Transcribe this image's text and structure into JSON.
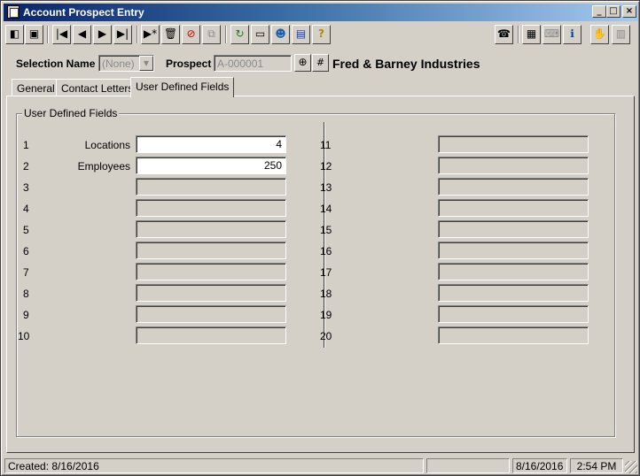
{
  "window": {
    "title": "Account Prospect Entry",
    "min_glyph": "_",
    "max_glyph": "□",
    "close_glyph": "×"
  },
  "toolbar": [
    {
      "name": "exit-icon",
      "glyph": "◧"
    },
    {
      "name": "save-icon",
      "glyph": "▣"
    },
    {
      "name": "first-record-icon",
      "glyph": "|◀"
    },
    {
      "name": "previous-record-icon",
      "glyph": "◀"
    },
    {
      "name": "next-record-icon",
      "glyph": "▶"
    },
    {
      "name": "last-record-icon",
      "glyph": "▶|"
    },
    {
      "name": "new-record-icon",
      "glyph": "▶*"
    },
    {
      "name": "delete-icon",
      "glyph": "🗑"
    },
    {
      "name": "cancel-icon",
      "glyph": "⊘"
    },
    {
      "name": "copy-icon",
      "glyph": "⧉"
    },
    {
      "name": "refresh-icon",
      "glyph": "↻"
    },
    {
      "name": "note-icon",
      "glyph": "▭"
    },
    {
      "name": "users-icon",
      "glyph": "☻"
    },
    {
      "name": "book-icon",
      "glyph": "▤"
    },
    {
      "name": "help-icon",
      "glyph": "?"
    },
    {
      "name": "phone-icon",
      "glyph": "☎"
    },
    {
      "name": "calculator-icon",
      "glyph": "▦"
    },
    {
      "name": "keyboard-icon",
      "glyph": "⌨"
    },
    {
      "name": "info-icon",
      "glyph": "ℹ"
    },
    {
      "name": "handshake-icon",
      "glyph": "✋"
    },
    {
      "name": "factory-icon",
      "glyph": "▥"
    }
  ],
  "header": {
    "selection_name_label": "Selection Name",
    "selection_name_value": "(None)",
    "dropdown_glyph": "▼",
    "prospect_label": "Prospect",
    "prospect_value": "A-000001",
    "zoom_glyph": "⊕",
    "number_glyph": "#",
    "prospect_name": "Fred & Barney Industries"
  },
  "tabs": [
    {
      "label": "General"
    },
    {
      "label": "Contact Letters"
    },
    {
      "label": "User Defined Fields"
    }
  ],
  "udf": {
    "group_title": "User Defined Fields",
    "left": [
      {
        "num": "1",
        "label": "Locations",
        "value": "4",
        "enabled": true
      },
      {
        "num": "2",
        "label": "Employees",
        "value": "250",
        "enabled": true
      },
      {
        "num": "3",
        "label": "",
        "value": "",
        "enabled": false
      },
      {
        "num": "4",
        "label": "",
        "value": "",
        "enabled": false
      },
      {
        "num": "5",
        "label": "",
        "value": "",
        "enabled": false
      },
      {
        "num": "6",
        "label": "",
        "value": "",
        "enabled": false
      },
      {
        "num": "7",
        "label": "",
        "value": "",
        "enabled": false
      },
      {
        "num": "8",
        "label": "",
        "value": "",
        "enabled": false
      },
      {
        "num": "9",
        "label": "",
        "value": "",
        "enabled": false
      },
      {
        "num": "10",
        "label": "",
        "value": "",
        "enabled": false
      }
    ],
    "right": [
      {
        "num": "11",
        "value": ""
      },
      {
        "num": "12",
        "value": ""
      },
      {
        "num": "13",
        "value": ""
      },
      {
        "num": "14",
        "value": ""
      },
      {
        "num": "15",
        "value": ""
      },
      {
        "num": "16",
        "value": ""
      },
      {
        "num": "17",
        "value": ""
      },
      {
        "num": "18",
        "value": ""
      },
      {
        "num": "19",
        "value": ""
      },
      {
        "num": "20",
        "value": ""
      }
    ]
  },
  "status": {
    "created": "Created: 8/16/2016",
    "date": "8/16/2016",
    "time": "2:54 PM"
  }
}
